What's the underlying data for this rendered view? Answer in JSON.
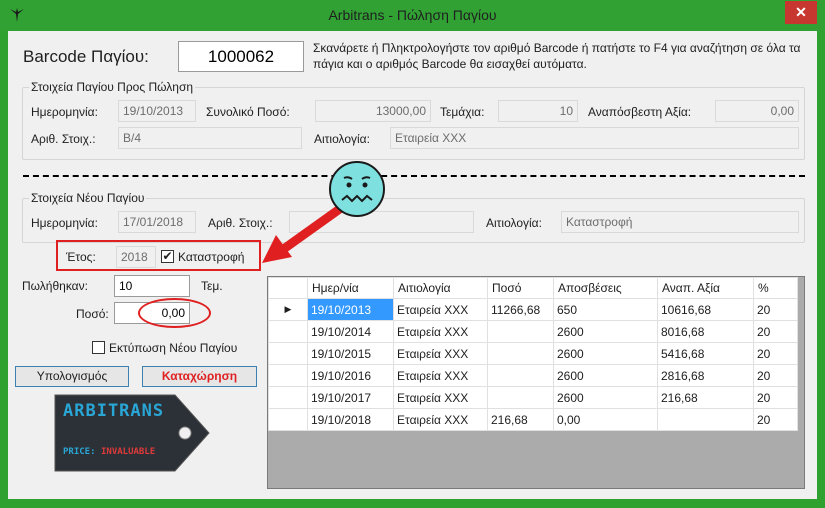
{
  "window": {
    "title": "Arbitrans - Πώληση Παγίου",
    "close_glyph": "✕"
  },
  "barcode": {
    "label": "Barcode Παγίου:",
    "value": "1000062",
    "help": "Σκανάρετε ή Πληκτρολογήστε τον αριθμό Barcode ή πατήστε το F4 για αναζήτηση σε όλα τα πάγια και ο αριθμός Barcode θα εισαχθεί αυτόματα."
  },
  "sale_group": {
    "title": "Στοιχεία Παγίου Προς Πώληση",
    "date_label": "Ημερομηνία:",
    "date_value": "19/10/2013",
    "total_label": "Συνολικό Ποσό:",
    "total_value": "13000,00",
    "pieces_label": "Τεμάχια:",
    "pieces_value": "10",
    "undepreciated_label": "Αναπόσβεστη Αξία:",
    "undepreciated_value": "0,00",
    "itemno_label": "Αριθ. Στοιχ.:",
    "itemno_value": "B/4",
    "reason_label": "Αιτιολογία:",
    "reason_value": "Εταιρεία XXX"
  },
  "new_group": {
    "title": "Στοιχεία Νέου Παγίου",
    "date_label": "Ημερομηνία:",
    "date_value": "17/01/2018",
    "itemno_label": "Αριθ. Στοιχ.:",
    "itemno_value": "",
    "reason_label": "Αιτιολογία:",
    "reason_value": "Καταστροφή"
  },
  "year": {
    "label": "Έτος:",
    "value": "2018",
    "checkbox_label": "Καταστροφή",
    "checked": true
  },
  "sold": {
    "label": "Πωλήθηκαν:",
    "value": "10",
    "unit": "Τεμ."
  },
  "amount": {
    "label": "Ποσό:",
    "value": "0,00"
  },
  "print_new": {
    "label": "Εκτύπωση Νέου Παγίου",
    "checked": false
  },
  "buttons": {
    "calculate": "Υπολογισμός",
    "register": "Καταχώρηση"
  },
  "grid": {
    "columns": [
      "Ημερ/νία",
      "Αιτιολογία",
      "Ποσό",
      "Αποσβέσεις",
      "Αναπ. Αξία",
      "%"
    ],
    "rows": [
      [
        "19/10/2013",
        "Εταιρεία XXX",
        "11266,68",
        "650",
        "10616,68",
        "20"
      ],
      [
        "19/10/2014",
        "Εταιρεία XXX",
        "",
        "2600",
        "8016,68",
        "20"
      ],
      [
        "19/10/2015",
        "Εταιρεία XXX",
        "",
        "2600",
        "5416,68",
        "20"
      ],
      [
        "19/10/2016",
        "Εταιρεία XXX",
        "",
        "2600",
        "2816,68",
        "20"
      ],
      [
        "19/10/2017",
        "Εταιρεία XXX",
        "",
        "2600",
        "216,68",
        "20"
      ],
      [
        "19/10/2018",
        "Εταιρεία XXX",
        "216,68",
        "0,00",
        "",
        "20"
      ]
    ],
    "current_row_marker": "▶"
  },
  "logo": {
    "brand": "ARBITRANS",
    "price_label": "PRICE:",
    "price_value": "INVALUABLE"
  },
  "colors": {
    "titlebar": "#31a134",
    "close": "#c7372f",
    "highlight": "#e02020",
    "selection": "#3399ff"
  }
}
